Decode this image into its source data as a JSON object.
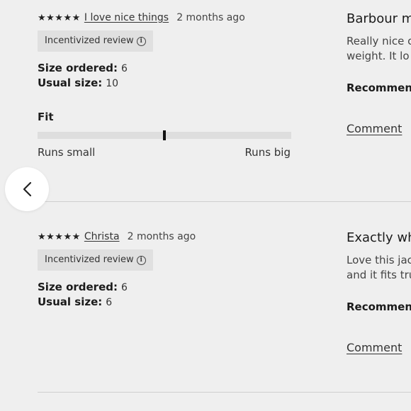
{
  "reviews": [
    {
      "stars": "★★★★★",
      "reviewer": "I love nice things",
      "date": "2 months ago",
      "badge": "Incentivized review",
      "size_ordered_label": "Size ordered:",
      "size_ordered": "6",
      "usual_size_label": "Usual size:",
      "usual_size": "10",
      "fit_label": "Fit",
      "fit_value": 0.5,
      "fit_low": "Runs small",
      "fit_high": "Runs big",
      "title": "Barbour m",
      "body_lines": [
        "Really nice c",
        "weight. It lo"
      ],
      "recommend": "Recommenc",
      "comment": "Comment"
    },
    {
      "stars": "★★★★★",
      "reviewer": "Christa",
      "date": "2 months ago",
      "badge": "Incentivized review",
      "size_ordered_label": "Size ordered:",
      "size_ordered": "6",
      "usual_size_label": "Usual size:",
      "usual_size": "6",
      "title": "Exactly wh",
      "body_lines": [
        "Love this jac",
        "and it fits tru"
      ],
      "recommend": "Recommenc",
      "comment": "Comment"
    }
  ],
  "icons": {
    "info": "info-icon",
    "back": "chevron-left-icon"
  }
}
